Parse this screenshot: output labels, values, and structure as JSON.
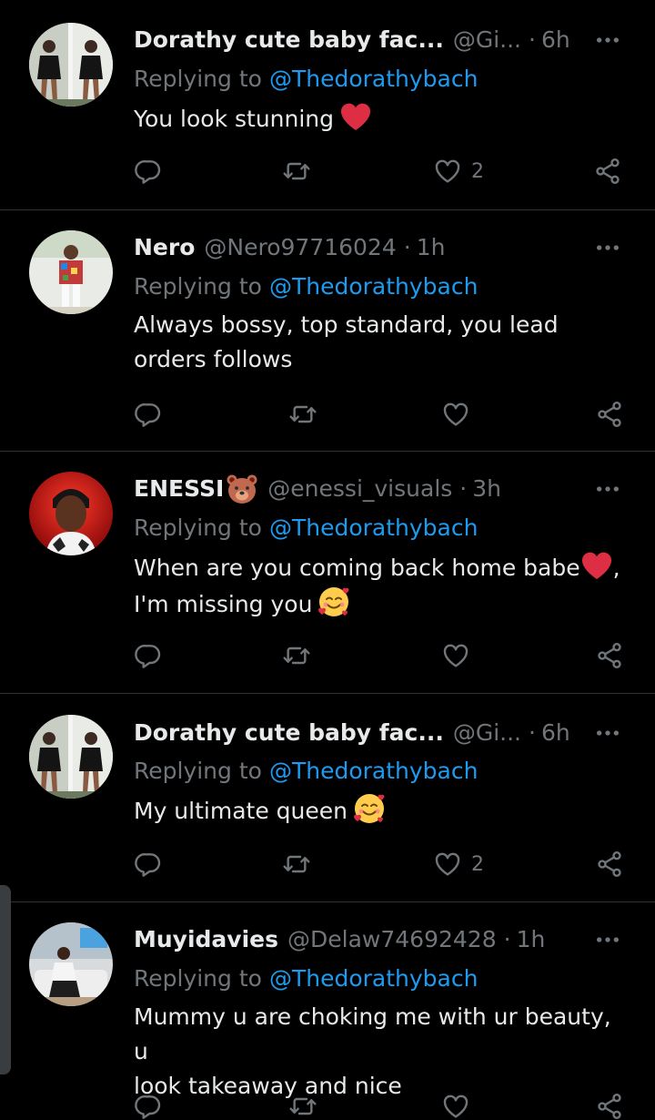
{
  "colors": {
    "background": "#000000",
    "primary_text": "#e7e9ea",
    "secondary_text": "#71767b",
    "mention": "#1d9bf0",
    "divider": "#2f3336"
  },
  "action_icons": [
    "reply-icon",
    "retweet-icon",
    "like-icon",
    "share-icon"
  ],
  "replies": [
    {
      "name": "Dorathy cute baby fac...",
      "handle": "@Gi...",
      "dot": "·",
      "time": "6h",
      "replying_label": "Replying to",
      "replying_to": "@Thedorathybach",
      "text_line1": "You look stunning",
      "text_line2": "",
      "emoji": "red-heart",
      "like_count": "2"
    },
    {
      "name": "Nero",
      "handle": "@Nero97716024",
      "dot": "·",
      "time": "1h",
      "replying_label": "Replying to",
      "replying_to": "@Thedorathybach",
      "text_line1": "Always bossy, top standard, you lead",
      "text_line2": "orders follows",
      "like_count": ""
    },
    {
      "name": "ENESSI",
      "name_emoji": "bear-face",
      "handle": "@enessi_visuals",
      "dot": "·",
      "time": "3h",
      "replying_label": "Replying to",
      "replying_to": "@Thedorathybach",
      "text_line1": "When are you coming back home babe",
      "text_line1_suffix": ",",
      "text_line2": "I'm missing you",
      "emoji_line1": "red-heart",
      "emoji_line2": "smiling-face-with-hearts",
      "like_count": ""
    },
    {
      "name": "Dorathy cute baby fac...",
      "handle": "@Gi...",
      "dot": "·",
      "time": "6h",
      "replying_label": "Replying to",
      "replying_to": "@Thedorathybach",
      "text_line1": "My ultimate queen",
      "text_line2": "",
      "emoji": "smiling-face-with-hearts",
      "like_count": "2"
    },
    {
      "name": "Muyidavies",
      "handle": "@Delaw74692428",
      "dot": "·",
      "time": "1h",
      "replying_label": "Replying to",
      "replying_to": "@Thedorathybach",
      "text_line1": "Mummy u are choking me with ur beauty, u",
      "text_line2": "look takeaway and nice",
      "like_count": ""
    }
  ]
}
